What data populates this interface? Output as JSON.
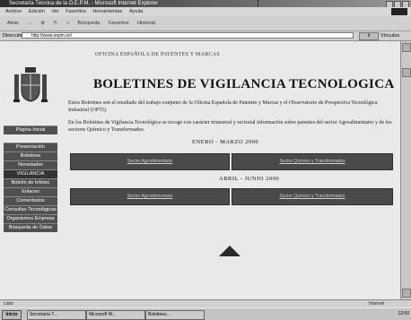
{
  "window": {
    "title": "Secretaría Técnica de la O.E.P.M. - Microsoft Internet Explorer"
  },
  "menu": [
    "Archivo",
    "Edición",
    "Ver",
    "Favoritos",
    "Herramientas",
    "Ayuda"
  ],
  "toolbar": {
    "back": "Atrás",
    "forward": "→",
    "stop": "⊗",
    "refresh": "↻",
    "home": "⌂",
    "search": "Búsqueda",
    "favorites": "Favoritos",
    "history": "Historial"
  },
  "address": {
    "label": "Dirección",
    "url": "http://www.oepm.es/",
    "go": "Ir",
    "links": "Vínculos"
  },
  "sidebar": {
    "items": [
      "Página Inicial",
      "Presentación",
      "Boletines",
      "Novedades",
      "VIGILANCIA",
      "Boletín de Infotec",
      "Enlaces",
      "Comentarios",
      "Consultas Tecnológicas",
      "Organismos Empresa",
      "Búsqueda de Datos"
    ]
  },
  "header": {
    "org": "OFICINA ESPAÑOLA DE PATENTES Y MARCAS"
  },
  "main": {
    "title": "BOLETINES DE VIGILANCIA TECNOLOGICA",
    "intro": "Estos Boletines son el resultado del trabajo conjunto de la Oficina Española de Patentes y Marcas y el Observatorio de Prospectiva Tecnológica Industrial (OPTI).",
    "description": "En los Boletines de Vigilancia Tecnológica se recoge con carácter trimestral y sectorial información sobre patentes del sector Agroalimentario y de los sectores Químico y Transformados.",
    "periods": [
      {
        "label": "ENERO - MARZO 2000",
        "buttons": [
          "Sector Agroalimentario",
          "Sector Químico y Transformados"
        ]
      },
      {
        "label": "ABRIL - JUNIO 2000",
        "buttons": [
          "Sector Agroalimentario",
          "Sector Químico y Transformados"
        ]
      }
    ]
  },
  "status": {
    "text": "Listo",
    "zone": "Internet"
  },
  "taskbar": {
    "start": "Inicio",
    "tasks": [
      "Secretaría T...",
      "Microsoft W...",
      "Boletines..."
    ],
    "clock": "12:00"
  }
}
